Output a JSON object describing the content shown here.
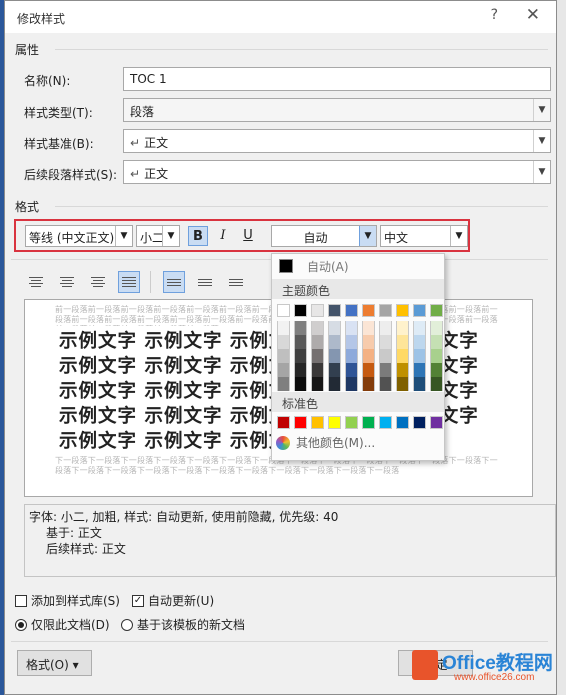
{
  "dialog": {
    "title": "修改样式",
    "help": "?",
    "close": "✕"
  },
  "props": {
    "header": "属性",
    "name_label": "名称(N):",
    "name_value": "TOC 1",
    "type_label": "样式类型(T):",
    "type_value": "段落",
    "based_label": "样式基准(B):",
    "based_value": "正文",
    "next_label": "后续段落样式(S):",
    "next_value": "正文"
  },
  "format": {
    "header": "格式",
    "font": "等线 (中文正文)",
    "size": "小二",
    "bold": "B",
    "italic": "I",
    "underline": "U",
    "color": "自动",
    "lang": "中文"
  },
  "color_menu": {
    "auto": "自动(A)",
    "theme_header": "主题颜色",
    "standard_header": "标准色",
    "more": "其他颜色(M)...",
    "theme_top": [
      "#ffffff",
      "#000000",
      "#e7e6e6",
      "#44546a",
      "#4472c4",
      "#ed7d31",
      "#a5a5a5",
      "#ffc000",
      "#5b9bd5",
      "#70ad47"
    ],
    "theme_shades": [
      [
        "#f2f2f2",
        "#7f7f7f",
        "#d0cece",
        "#d6dce4",
        "#d9e2f3",
        "#fbe5d5",
        "#ededed",
        "#fff2cc",
        "#deebf6",
        "#e2efd9"
      ],
      [
        "#d8d8d8",
        "#595959",
        "#aeabab",
        "#adb9ca",
        "#b4c6e7",
        "#f7cbac",
        "#dbdbdb",
        "#fee599",
        "#bdd7ee",
        "#c5e0b3"
      ],
      [
        "#bfbfbf",
        "#3f3f3f",
        "#757070",
        "#8496b0",
        "#8eaadb",
        "#f4b183",
        "#c9c9c9",
        "#ffd965",
        "#9dc3e6",
        "#a8d08d"
      ],
      [
        "#a5a5a5",
        "#262626",
        "#3a3838",
        "#323f4f",
        "#2f5496",
        "#c55a11",
        "#7b7b7b",
        "#bf9000",
        "#2e75b5",
        "#538135"
      ],
      [
        "#7f7f7f",
        "#0c0c0c",
        "#171616",
        "#222a35",
        "#1f3864",
        "#833c0b",
        "#525252",
        "#7f6000",
        "#1e4e79",
        "#375623"
      ]
    ],
    "standard": [
      "#c00000",
      "#ff0000",
      "#ffc000",
      "#ffff00",
      "#92d050",
      "#00b050",
      "#00b0f0",
      "#0070c0",
      "#002060",
      "#7030a0"
    ]
  },
  "preview": {
    "before": "前一段落前一段落前一段落前一段落前一段落前一段落前一段落前一段落前一段落前一段落前一段落前一段落前一段落前一段落前一段落前一段落前一段落前一段落前一段落前一段落前一段落前一段落前一段落前一段落前一段落前一段落前一段落前一段落前一段落前一段落前一段落前一段落",
    "sample": "示例文字 示例文字 示例文字 示例文字 示例文字 示例文字 示例文字 示例文字 示例文字 示例文字 示例文字 示例文字 示例文字 示例文字 示例文字 示例文字 示例文字 示例文字 示例文字 示例文字 示例文字 示例文字 示例文字",
    "after": "下一段落下一段落下一段落下一段落下一段落下一段落下一段落下一段落下一段落下一段落下一段落下一段落下一段落下一段落下一段落下一段落下一段落下一段落下一段落下一段落下一段落下一段落下一段落下一段落"
  },
  "description": {
    "line1": "字体: 小二, 加粗, 样式: 自动更新, 使用前隐藏, 优先级: 40",
    "line2": "基于: 正文",
    "line3": "后续样式: 正文"
  },
  "options": {
    "add_gallery": "添加到样式库(S)",
    "auto_update": "自动更新(U)",
    "only_doc": "仅限此文档(D)",
    "template": "基于该模板的新文档"
  },
  "buttons": {
    "format": "格式(O) ▾",
    "ok": "确定"
  },
  "watermark": {
    "brand": "Office教程网",
    "url": "www.office26.com"
  }
}
